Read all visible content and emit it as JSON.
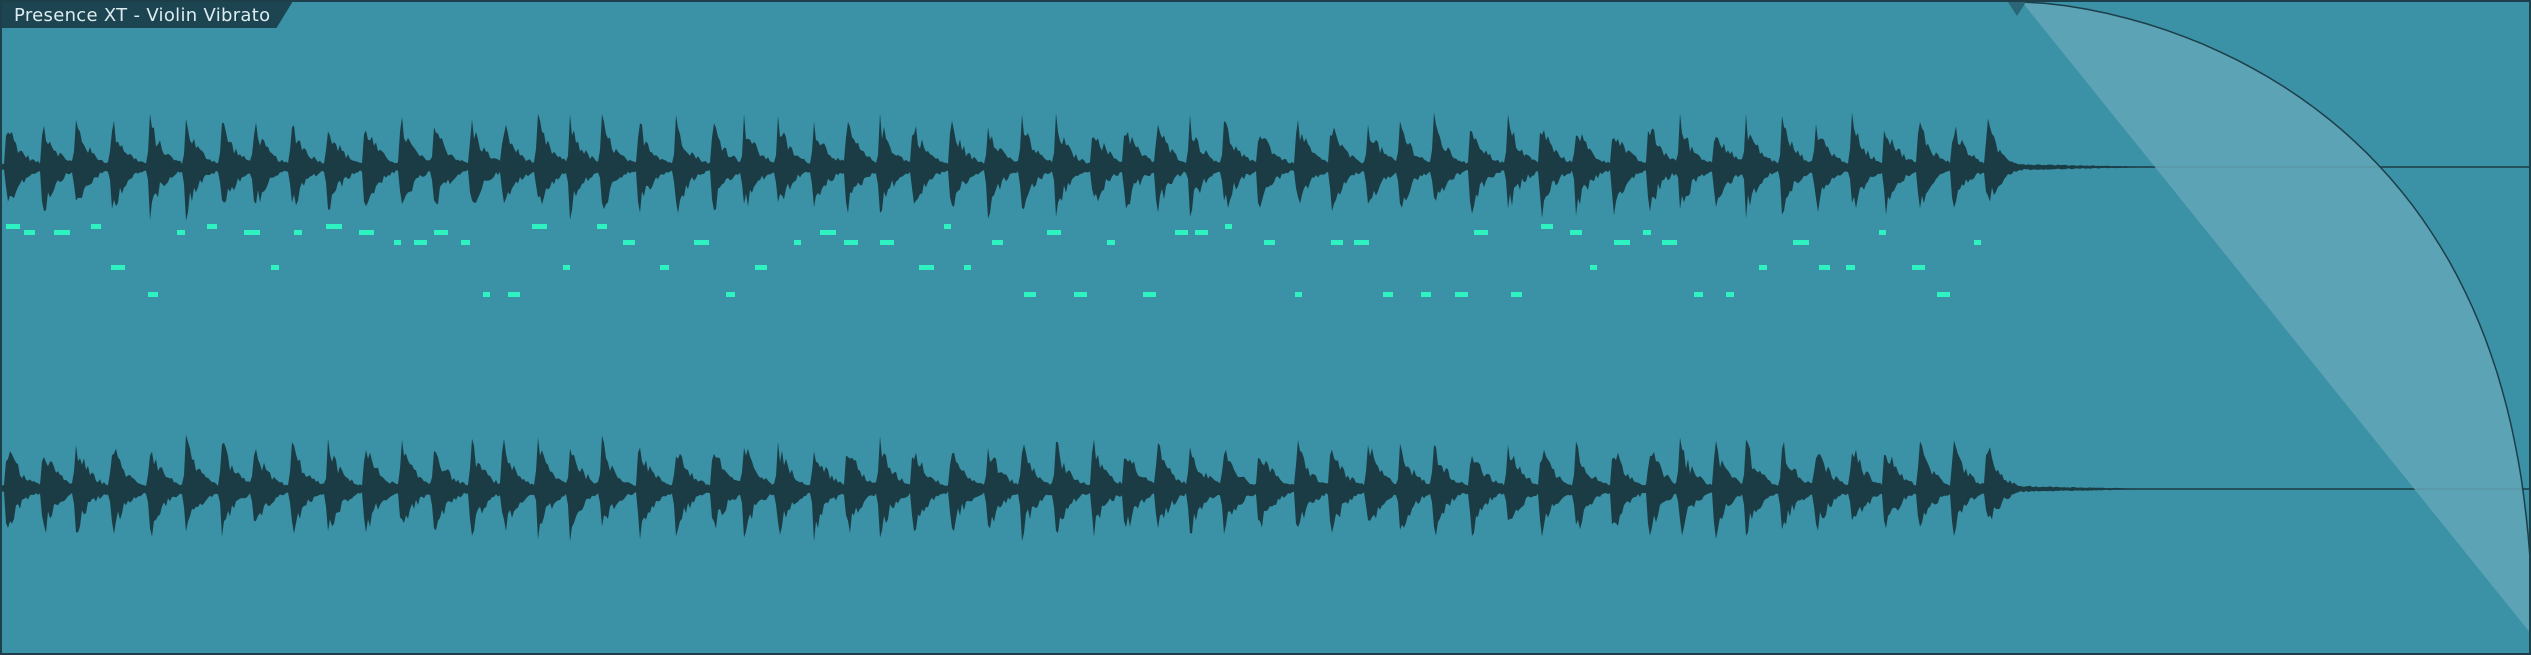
{
  "event": {
    "title": "Presence XT - Violin Vibrato"
  },
  "colors": {
    "background": "#3b91a5",
    "waveform": "#1b3c45",
    "midi_note": "#2ef3c0",
    "fade_overlay": "#64a6b8",
    "title_tab": "#1d4451",
    "border": "#1c3f4a"
  },
  "icons": {
    "fade_out_handle": "fade-handle-icon"
  }
}
